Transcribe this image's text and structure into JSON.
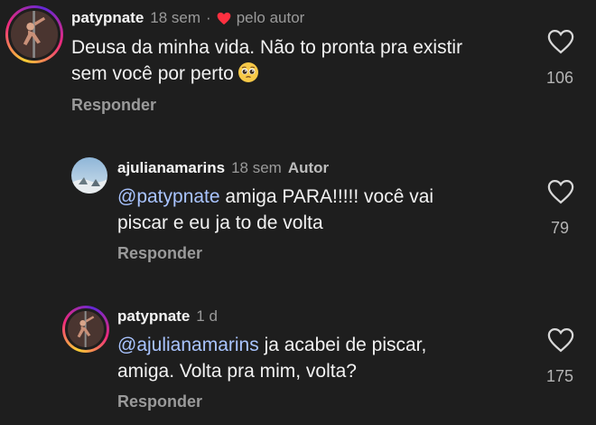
{
  "comments": [
    {
      "username": "patypnate",
      "time": "18 sem",
      "separator": "·",
      "liked_by_author_label": "pelo autor",
      "text_line1": "Deusa da minha vida. Não to pronta pra existir",
      "text_line2": "sem você por perto",
      "emoji": "pleading-face",
      "reply_label": "Responder",
      "likes": "106"
    },
    {
      "username": "ajulianamarins",
      "time": "18 sem",
      "author_label": "Autor",
      "mention": "@patypnate",
      "text_line1": " amiga PARA!!!!! você vai",
      "text_line2": "piscar e eu ja to de volta",
      "reply_label": "Responder",
      "likes": "79"
    },
    {
      "username": "patypnate",
      "time": "1 d",
      "mention": "@ajulianamarins",
      "text_line1": " ja acabei de piscar,",
      "text_line2": "amiga. Volta pra mim, volta?",
      "reply_label": "Responder",
      "likes": "175"
    }
  ],
  "colors": {
    "background": "#1e1e1e",
    "mention": "#a9c4ff",
    "heart": "#ff3040",
    "muted": "#9a9a9a"
  },
  "icons": {
    "like": "heart-outline-icon",
    "liked_by_author": "heart-filled-icon"
  }
}
